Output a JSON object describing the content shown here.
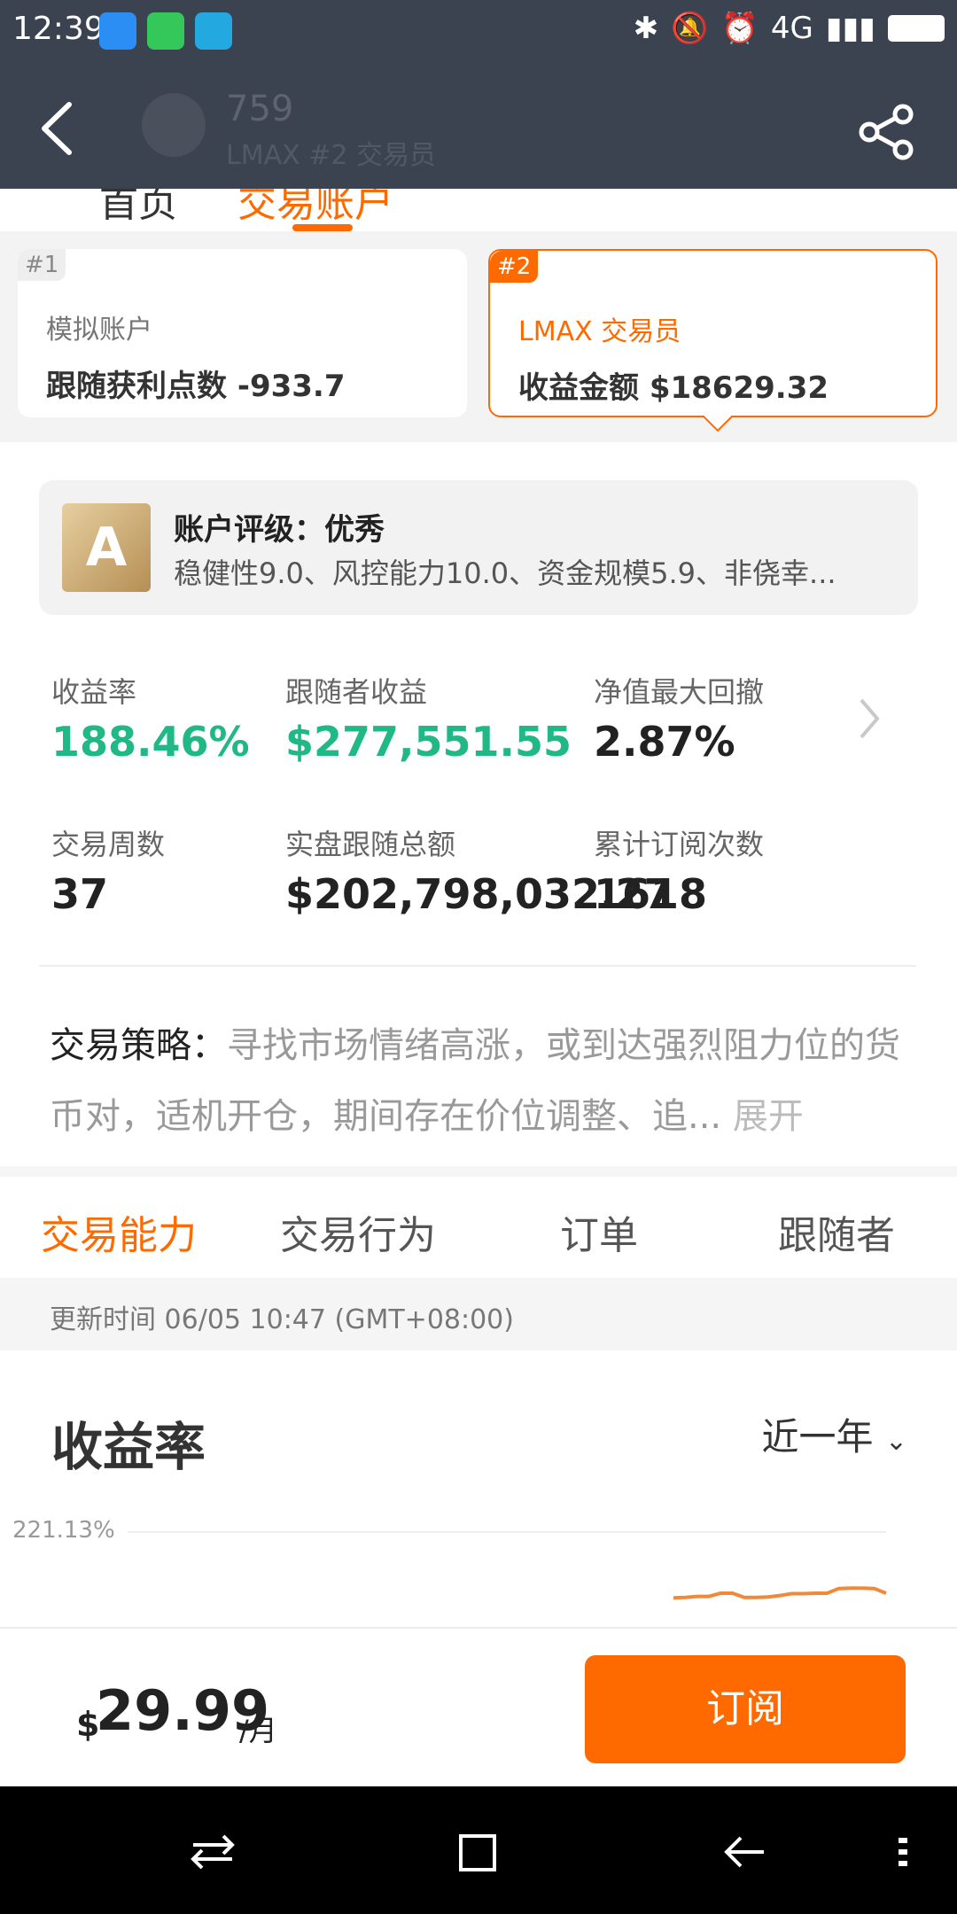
{
  "status_bar": {
    "time": "12:39",
    "network": "4G",
    "app_icons": [
      "message-icon",
      "plus-app-icon",
      "ball-app-icon"
    ]
  },
  "header": {
    "title": "759",
    "subtitle": "LMAX #2 交易员",
    "back_icon": "chevron-left-icon",
    "share_icon": "share-icon"
  },
  "top_tabs": [
    "首页",
    "交易账户"
  ],
  "accounts": [
    {
      "badge": "#1",
      "label": "模拟账户",
      "value": "跟随获利点数 -933.7"
    },
    {
      "badge": "#2",
      "label": "LMAX 交易员",
      "value": "收益金额 $18629.32"
    }
  ],
  "rating": {
    "grade": "A",
    "title": "账户评级：优秀",
    "desc": "稳健性9.0、风控能力10.0、资金规模5.9、非侥幸..."
  },
  "stats": [
    {
      "label": "收益率",
      "value": "188.46%"
    },
    {
      "label": "跟随者收益",
      "value": "$277,551.55"
    },
    {
      "label": "净值最大回撤",
      "value": "2.87%"
    },
    {
      "label": "交易周数",
      "value": "37"
    },
    {
      "label": "实盘跟随总额",
      "value": "$202,798,032.27"
    },
    {
      "label": "累计订阅次数",
      "value": "1618"
    }
  ],
  "strategy": {
    "head": "交易策略：",
    "text": "寻找市场情绪高涨，或到达强烈阻力位的货币对，适机开仓，期间存在价位调整、追...",
    "more": "展开"
  },
  "content_tabs": [
    "交易能力",
    "交易行为",
    "订单",
    "跟随者"
  ],
  "update_time": "更新时间 06/05 10:47 (GMT+08:00)",
  "chart": {
    "title": "收益率",
    "period": "近一年",
    "axis_top": "221.13%"
  },
  "chart_data": {
    "type": "line",
    "title": "收益率",
    "y_top_label": "221.13%",
    "series": [
      {
        "values": [
          0.855,
          0.86,
          0.87,
          0.87,
          0.905,
          0.905,
          0.86,
          0.86,
          0.865,
          0.88,
          0.9,
          0.9,
          0.905,
          0.905,
          0.955,
          0.96,
          0.96,
          0.955,
          0.905
        ]
      }
    ],
    "colors": {
      "line": "#f08a3a"
    }
  },
  "footer": {
    "currency": "$",
    "price": "29.99",
    "unit": "/月",
    "subscribe": "订阅"
  },
  "nav": {
    "icons": [
      "switch-icon",
      "home-square-icon",
      "back-arrow-icon",
      "menu-dots-icon"
    ]
  },
  "colors": {
    "accent": "#ff6a00",
    "green": "#20b985",
    "header_bg": "#3c4350"
  }
}
